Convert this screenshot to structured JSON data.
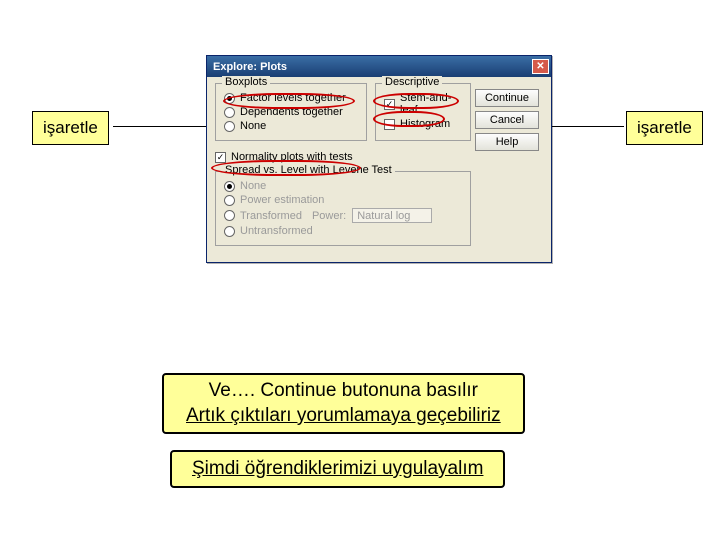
{
  "anno": {
    "left": "işaretle",
    "right": "işaretle",
    "mid1_line1": "Ve…. Continue butonuna basılır",
    "mid1_line2": "Artık çıktıları yorumlamaya geçebiliriz",
    "mid2": "Şimdi öğrendiklerimizi uygulayalım"
  },
  "win": {
    "title": "Explore: Plots",
    "buttons": {
      "continue": "Continue",
      "cancel": "Cancel",
      "help": "Help"
    },
    "boxplots": {
      "legend": "Boxplots",
      "opt1": "Factor levels together",
      "opt2": "Dependents together",
      "opt3": "None"
    },
    "descriptive": {
      "legend": "Descriptive",
      "opt1": "Stem-and-leaf",
      "opt2": "Histogram"
    },
    "normality": "Normality plots with tests",
    "spread": {
      "legend": "Spread vs. Level with Levene Test",
      "opt1": "None",
      "opt2": "Power estimation",
      "opt3": "Transformed",
      "opt4": "Untransformed",
      "power_label": "Power:",
      "power_value": "Natural log"
    }
  }
}
